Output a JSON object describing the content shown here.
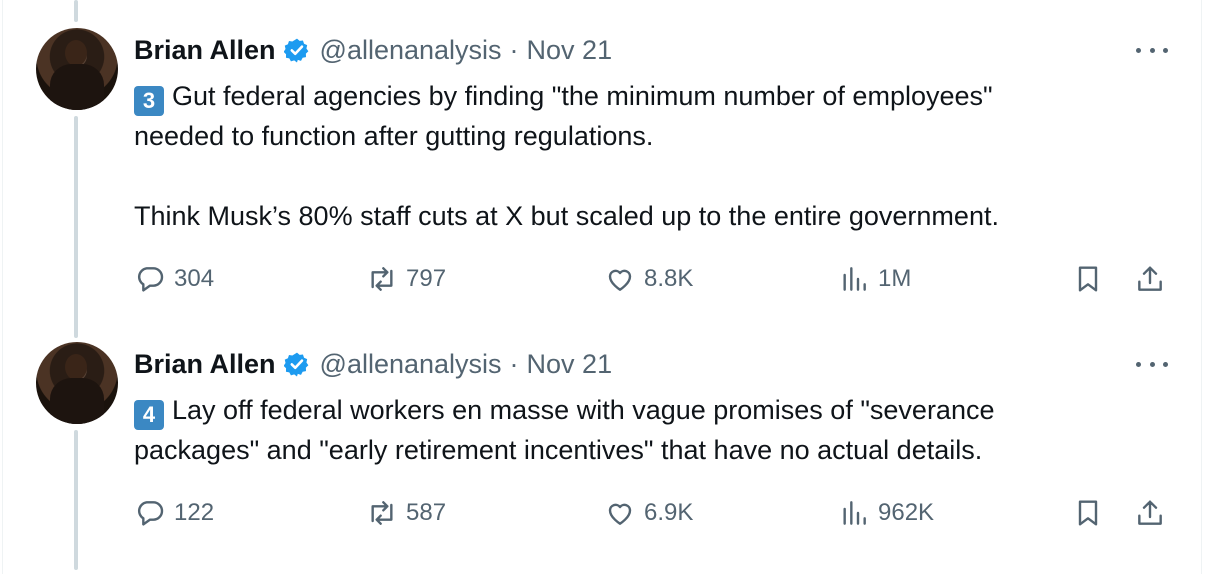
{
  "tweets": [
    {
      "author_name": "Brian Allen",
      "handle": "@allenanalysis",
      "separator": "·",
      "date": "Nov 21",
      "keycap": "3",
      "text_lines": [
        "Gut federal agencies by finding \"the minimum number of employees\"",
        "needed to function after gutting regulations."
      ],
      "text_para2": "Think Musk’s 80% staff cuts at X but scaled up to the entire government.",
      "replies": "304",
      "reposts": "797",
      "likes": "8.8K",
      "views": "1M"
    },
    {
      "author_name": "Brian Allen",
      "handle": "@allenanalysis",
      "separator": "·",
      "date": "Nov 21",
      "keycap": "4",
      "text_lines": [
        "Lay off federal workers en masse with vague promises of \"severance",
        "packages\" and \"early retirement incentives\" that have no actual details."
      ],
      "replies": "122",
      "reposts": "587",
      "likes": "6.9K",
      "views": "962K"
    }
  ],
  "icons": {
    "verified": "verified-badge-icon",
    "more": "more-dots-icon",
    "reply": "reply-icon",
    "repost": "repost-icon",
    "like": "like-icon",
    "views": "views-icon",
    "bookmark": "bookmark-icon",
    "share": "share-icon"
  },
  "colors": {
    "verified_blue": "#1d9bf0",
    "keycap_blue": "#3b88c3",
    "secondary_text": "#536471",
    "thread_line": "#cfd9de"
  }
}
